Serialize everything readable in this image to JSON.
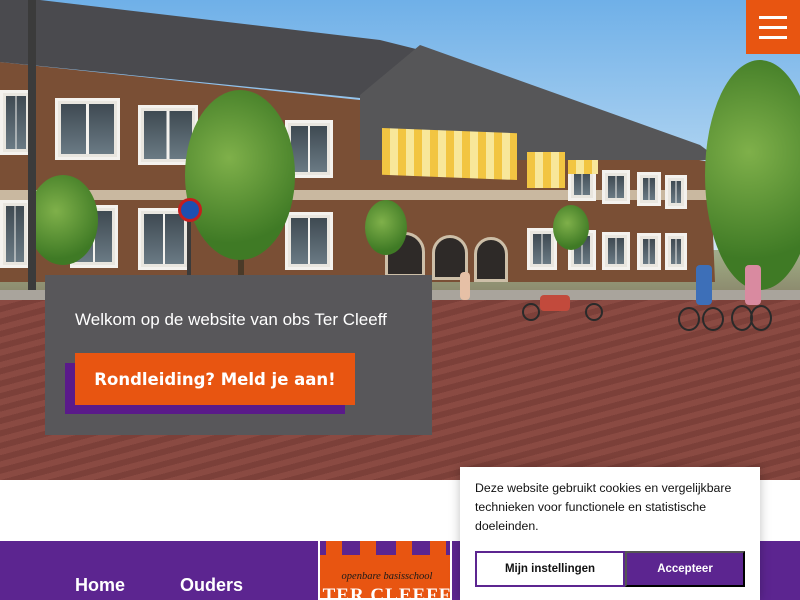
{
  "header": {
    "menu_icon": "hamburger-menu-icon",
    "accent_color": "#e85511"
  },
  "hero": {
    "welcome_text": "Welkom op de website van obs Ter Cleeff",
    "cta_label": "Rondleiding? Meld je aan!"
  },
  "footer": {
    "background_color": "#5c2590",
    "nav": [
      {
        "label": "Home"
      },
      {
        "label": "Ouders"
      }
    ],
    "logo": {
      "subtitle": "openbare basisschool",
      "name": "TER CLEEFF"
    }
  },
  "cookie_banner": {
    "message": "Deze website gebruikt cookies en vergelijkbare technieken voor functionele en statistische doeleinden.",
    "settings_label": "Mijn instellingen",
    "accept_label": "Accepteer"
  }
}
